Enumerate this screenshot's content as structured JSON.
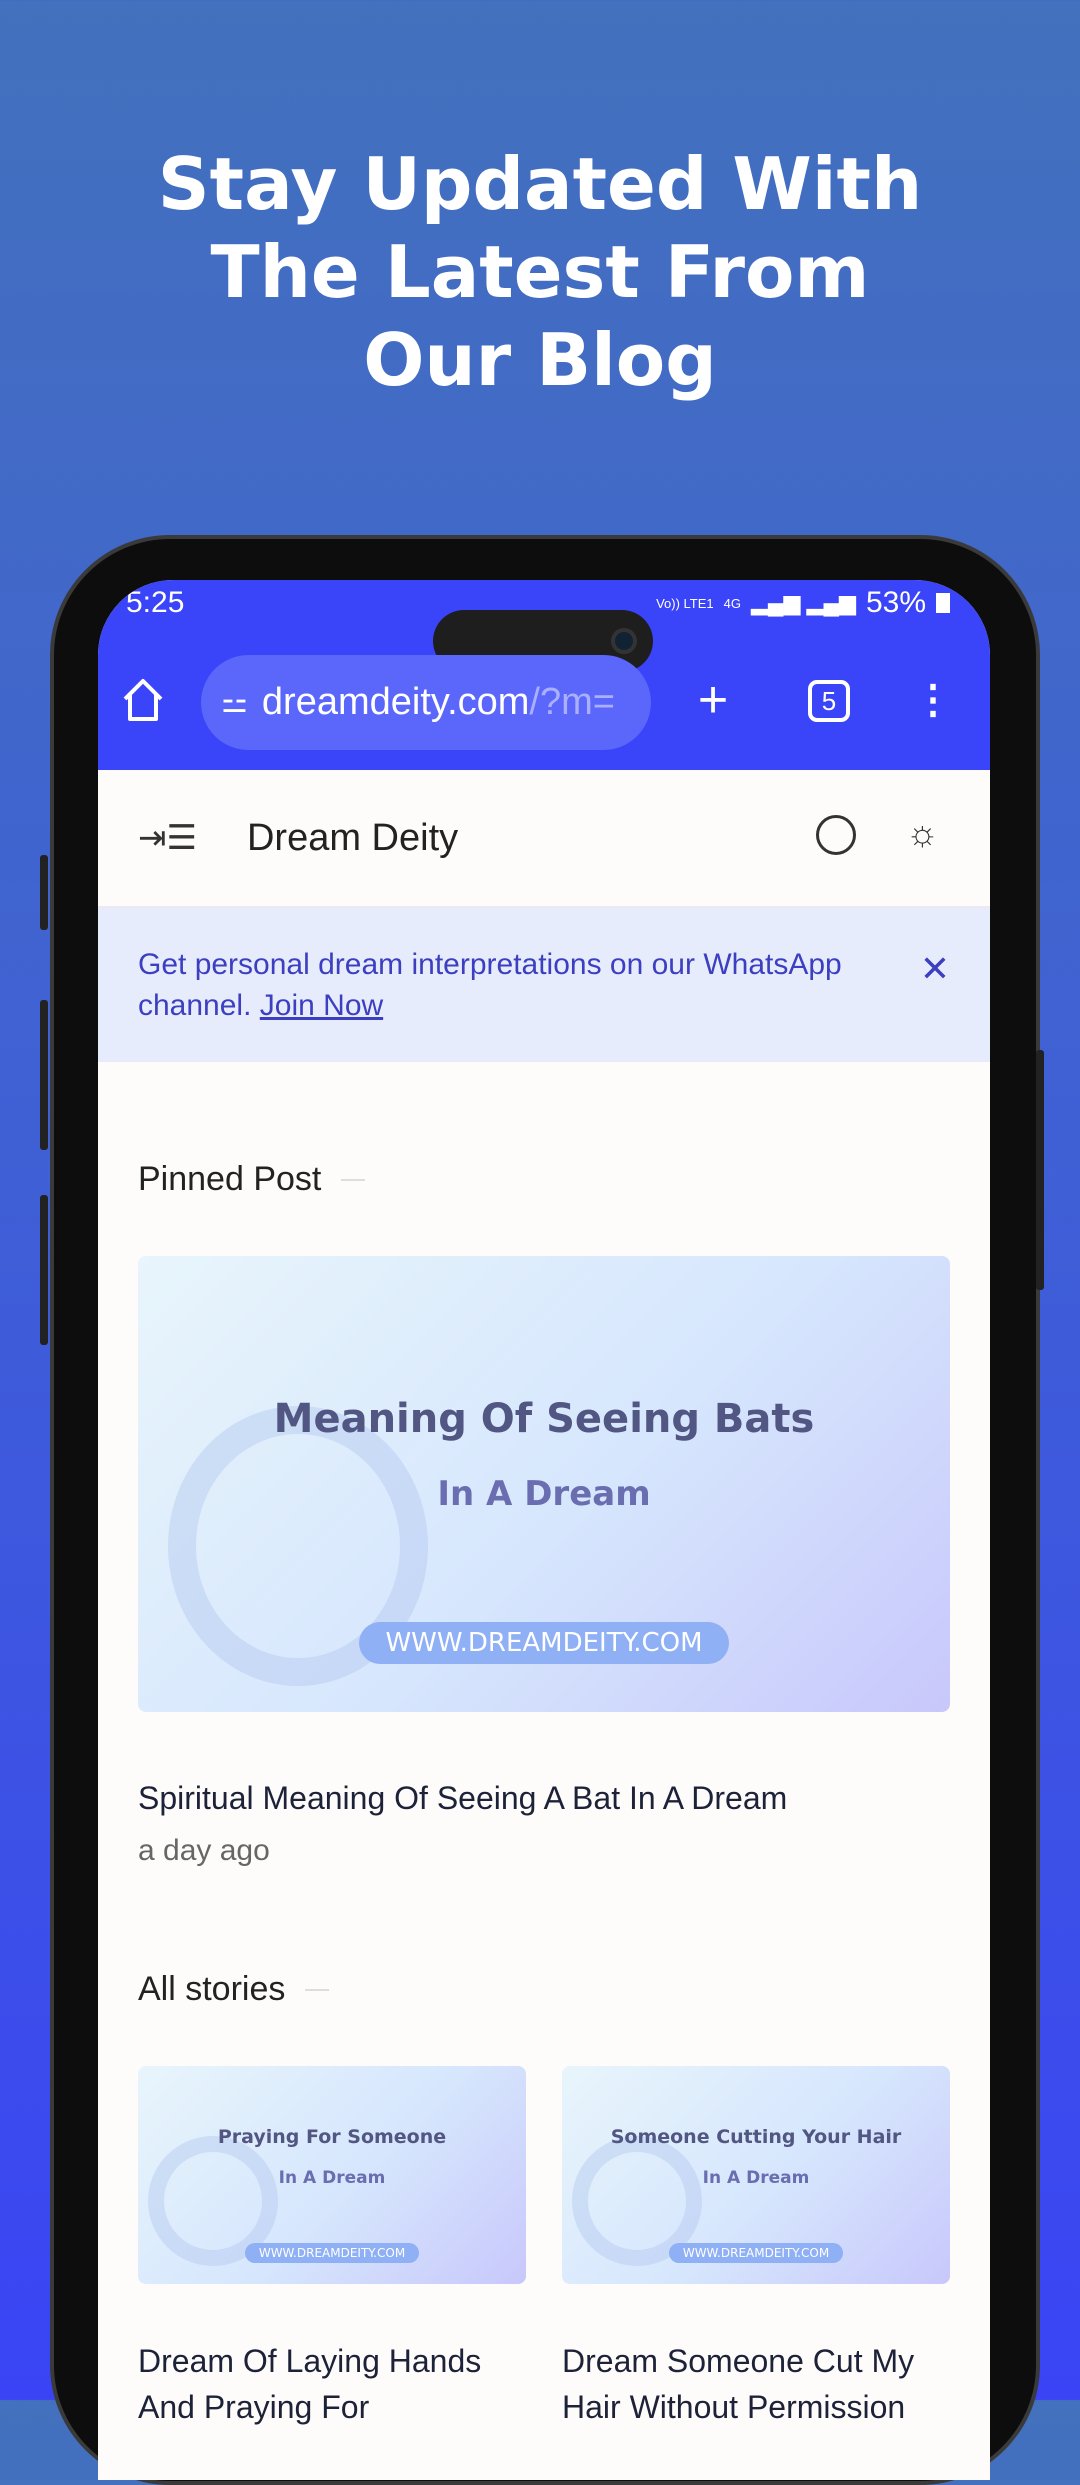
{
  "promo": {
    "headline_lines": [
      "Stay Updated With",
      "The Latest From",
      "Our Blog"
    ]
  },
  "status_bar": {
    "time": "5:25",
    "volte": "Vo)) LTE1",
    "network": "4G",
    "battery": "53%"
  },
  "browser": {
    "url_main": "dreamdeity.com",
    "url_rest": "/?m=",
    "tab_count": "5"
  },
  "site": {
    "title": "Dream Deity"
  },
  "banner": {
    "text": "Get personal dream interpretations on our WhatsApp channel.",
    "link": "Join Now"
  },
  "pinned": {
    "label": "Pinned Post",
    "image_title": "Meaning Of Seeing Bats",
    "image_subtitle": "In A Dream",
    "image_url": "WWW.DREAMDEITY.COM",
    "title": "Spiritual Meaning Of Seeing A Bat In A Dream",
    "time": "a day ago"
  },
  "stories": {
    "label": "All stories",
    "items": [
      {
        "image_title": "Praying For Someone",
        "image_subtitle": "In A Dream",
        "image_url": "WWW.DREAMDEITY.COM",
        "title_line1": "Dream Of Laying Hands",
        "title_line2": "And Praying For"
      },
      {
        "image_title": "Someone Cutting Your Hair",
        "image_subtitle": "In A Dream",
        "image_url": "WWW.DREAMDEITY.COM",
        "title_line1": "Dream Someone Cut My",
        "title_line2": "Hair Without Permission"
      }
    ]
  }
}
